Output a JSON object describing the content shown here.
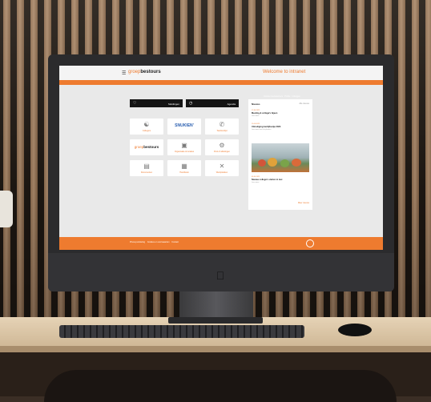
{
  "header": {
    "menu_icon": "hamburger-icon",
    "logo_prefix": "groep",
    "logo_name": "bestours",
    "welcome": "Welcome to intranet"
  },
  "subnav": [
    "Intranet medewerkers",
    "Profiel",
    "Uitloggen"
  ],
  "quick_buttons": [
    {
      "icon": "bell-icon",
      "label": "Meldingen"
    },
    {
      "icon": "clock-icon",
      "label": "Agenda"
    }
  ],
  "tiles": [
    {
      "icon": "people-icon",
      "label": "Collega's"
    },
    {
      "icon": "brand-logo",
      "label": "SNUKIEN'",
      "brand": true
    },
    {
      "icon": "phone-icon",
      "label": "Telefoonlijst"
    },
    {
      "icon": "brand-logo",
      "label": "bestours",
      "brand2": true
    },
    {
      "icon": "building-icon",
      "label": "Organisatie & locaties"
    },
    {
      "icon": "cog-icon",
      "label": "Pool of afdelingen"
    },
    {
      "icon": "document-icon",
      "label": "Documenten"
    },
    {
      "icon": "book-icon",
      "label": "Handboek"
    },
    {
      "icon": "tools-icon",
      "label": "Werkplekken"
    }
  ],
  "news": {
    "title": "Nieuws",
    "view_all": "Alle nieuws",
    "items": [
      {
        "date": "17-04-2023",
        "title": "Meeting & collega's bijeen",
        "snippet": "Lees meer"
      },
      {
        "date": "11-04-2023",
        "title": "Uitnodiging bedrijfsuitje 2023",
        "snippet": "Lees meer over de plannen"
      },
      {
        "date": "03-04-2023",
        "title": "Nieuwe collega's starten in mei",
        "snippet": "Lees meer"
      }
    ],
    "more": "Meer nieuws"
  },
  "footer": {
    "links": [
      "Privacyverklaring",
      "Cookies en voorwaarden",
      "Contact"
    ],
    "icon": "globe-icon"
  },
  "colors": {
    "accent": "#ee7b2f",
    "dark": "#141414",
    "screen_bg": "#e9e9e9"
  }
}
